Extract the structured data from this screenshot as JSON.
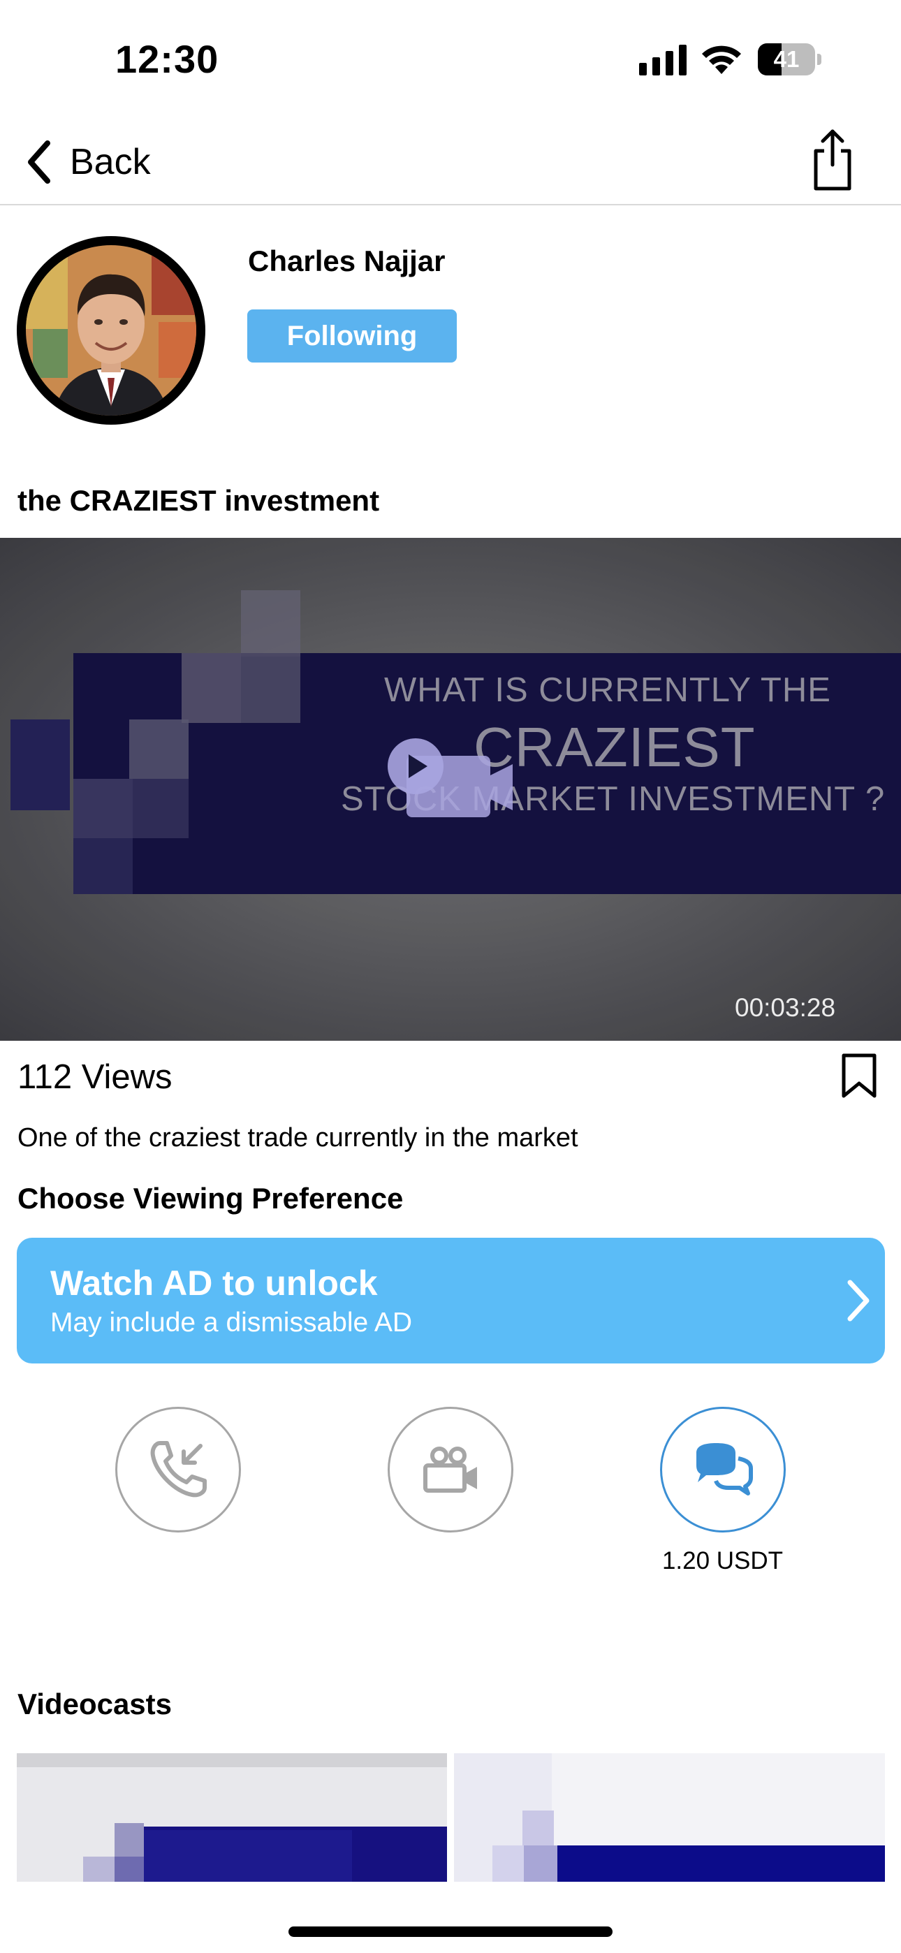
{
  "status_bar": {
    "time": "12:30",
    "battery_level": "41",
    "battery_fraction": 0.41,
    "icons": [
      "signal-icon",
      "wifi-icon",
      "battery-icon"
    ]
  },
  "nav": {
    "back_label": "Back",
    "back_icon": "chevron-left-icon",
    "share_icon": "share-icon"
  },
  "creator": {
    "name": "Charles Najjar",
    "follow_label": "Following"
  },
  "video": {
    "title": "the CRAZIEST investment",
    "overlay_line1": "WHAT IS CURRENTLY THE",
    "overlay_line2": "CRAZIEST",
    "overlay_line3": "STOCK MARKET INVESTMENT ?",
    "duration": "00:03:28",
    "play_icon": "play-video-icon"
  },
  "info": {
    "views": "112 Views",
    "description": "One of the craziest trade currently in the market",
    "preference_heading": "Choose Viewing Preference"
  },
  "watch_ad": {
    "title": "Watch AD to unlock",
    "subtitle": "May include a dismissable AD"
  },
  "options": [
    {
      "icon": "phone-call-icon",
      "price": ""
    },
    {
      "icon": "video-camera-icon",
      "price": ""
    },
    {
      "icon": "chat-bubbles-icon",
      "price": "1.20 USDT"
    }
  ],
  "videocasts": {
    "heading": "Videocasts"
  },
  "colors": {
    "accent": "#5bb3ef",
    "watch_card": "#5bbcf7",
    "active_ring": "#3b8fd4",
    "inactive_ring": "#a6a6a6",
    "video_banner": "#161243"
  }
}
